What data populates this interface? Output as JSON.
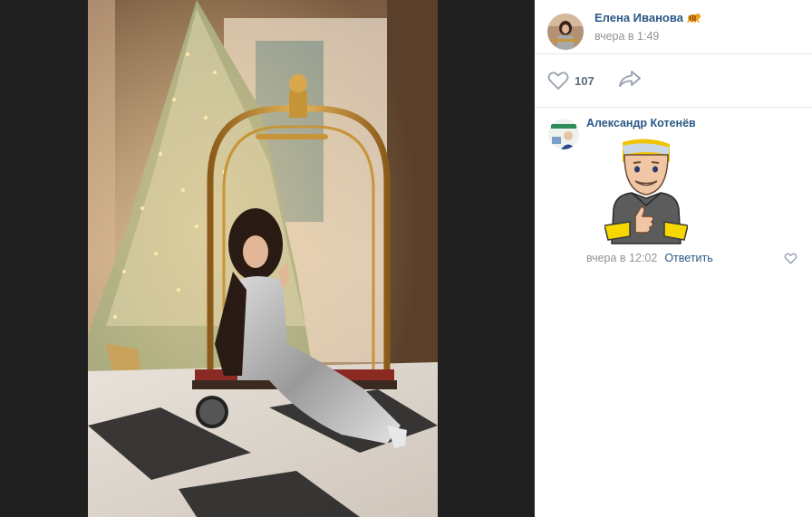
{
  "post": {
    "author_name": "Елена Иванова",
    "author_badge_icon": "tiger-emoji-icon",
    "time": "вчера в 1:49",
    "likes": "107"
  },
  "comment": {
    "author_name": "Александр Котенёв",
    "time": "вчера в 12:02",
    "reply_label": "Ответить"
  },
  "colors": {
    "link": "#2a5885",
    "muted": "#939393",
    "background": "#222222"
  }
}
